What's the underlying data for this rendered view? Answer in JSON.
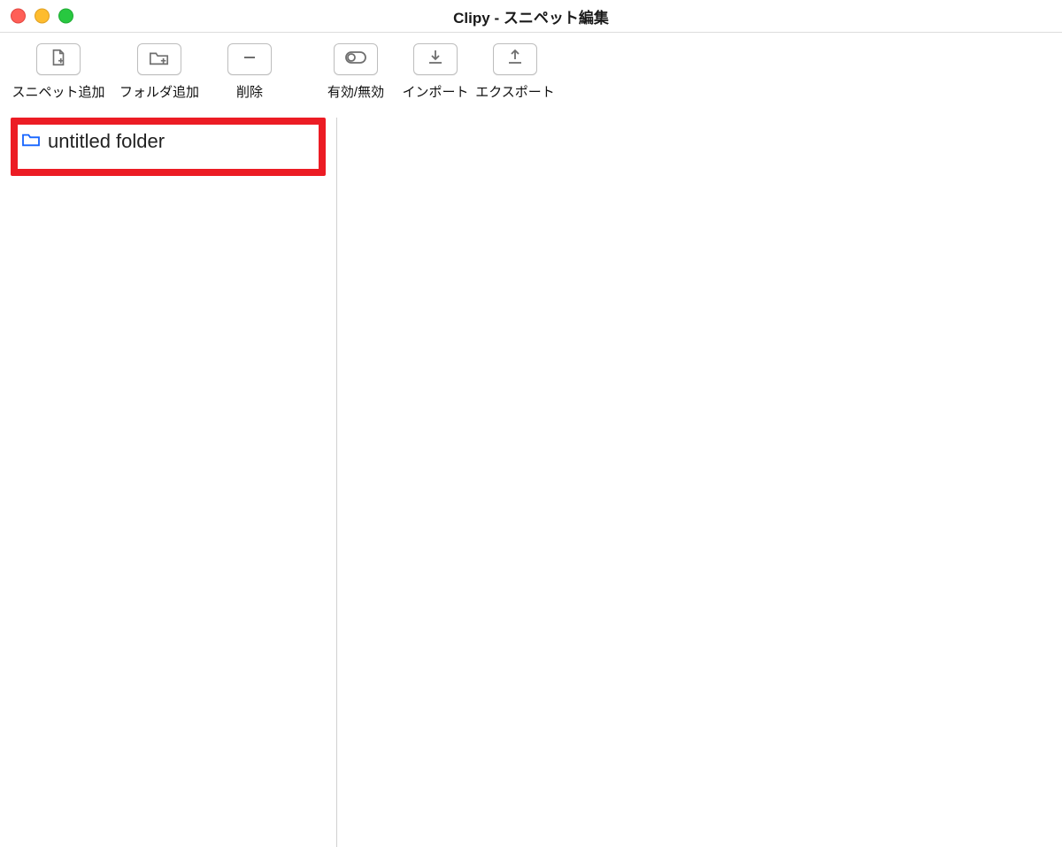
{
  "window": {
    "title": "Clipy - スニペット編集"
  },
  "toolbar": {
    "add_snippet_label": "スニペット追加",
    "add_folder_label": "フォルダ追加",
    "delete_label": "削除",
    "enable_disable_label": "有効/無効",
    "import_label": "インポート",
    "export_label": "エクスポート"
  },
  "sidebar": {
    "items": [
      {
        "label": "untitled folder",
        "icon": "folder-icon"
      }
    ]
  },
  "highlight": {
    "color": "#ec1c24"
  }
}
